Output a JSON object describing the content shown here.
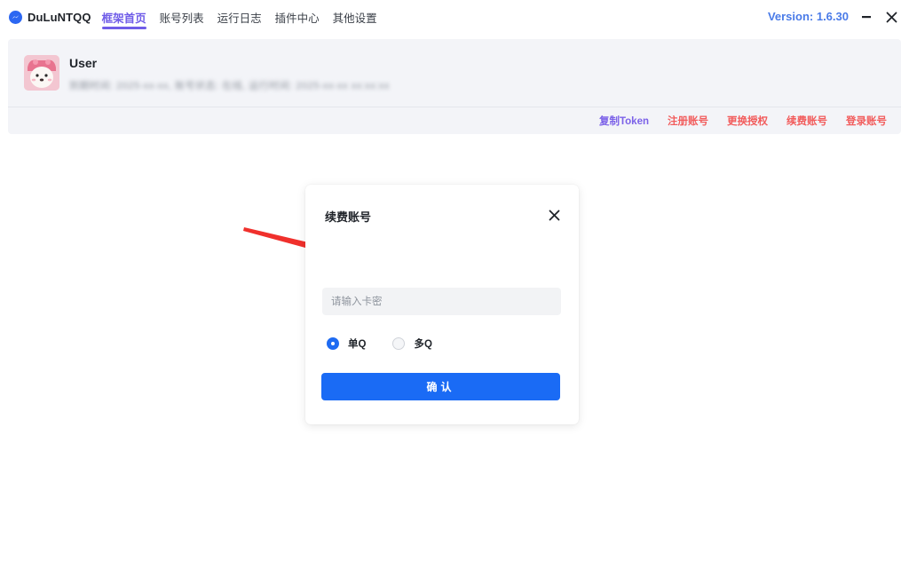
{
  "app": {
    "name": "DuLuNTQQ",
    "version": "Version: 1.6.30",
    "logo_icon": "messenger-bolt-icon",
    "accent_color": "#6f5ce8",
    "primary_color": "#1a6bf5"
  },
  "nav": {
    "tabs": [
      {
        "label": "框架首页",
        "active": true
      },
      {
        "label": "账号列表",
        "active": false
      },
      {
        "label": "运行日志",
        "active": false
      },
      {
        "label": "插件中心",
        "active": false
      },
      {
        "label": "其他设置",
        "active": false
      }
    ]
  },
  "window_controls": {
    "minimize_icon": "minimize-icon",
    "close_icon": "close-icon"
  },
  "user": {
    "name": "User",
    "meta_redacted": "到期时间: 2025-xx-xx, 账号状态: 在线, 运行时间: 2025-xx-xx xx:xx:xx"
  },
  "actions": {
    "copy_token": "复制Token",
    "register": "注册账号",
    "change_auth": "更换授权",
    "renew": "续费账号",
    "login": "登录账号"
  },
  "dialog": {
    "title": "续费账号",
    "input_placeholder": "请输入卡密",
    "input_value": "",
    "options": [
      {
        "label": "单Q",
        "checked": true
      },
      {
        "label": "多Q",
        "checked": false
      }
    ],
    "confirm_label": "确认"
  }
}
